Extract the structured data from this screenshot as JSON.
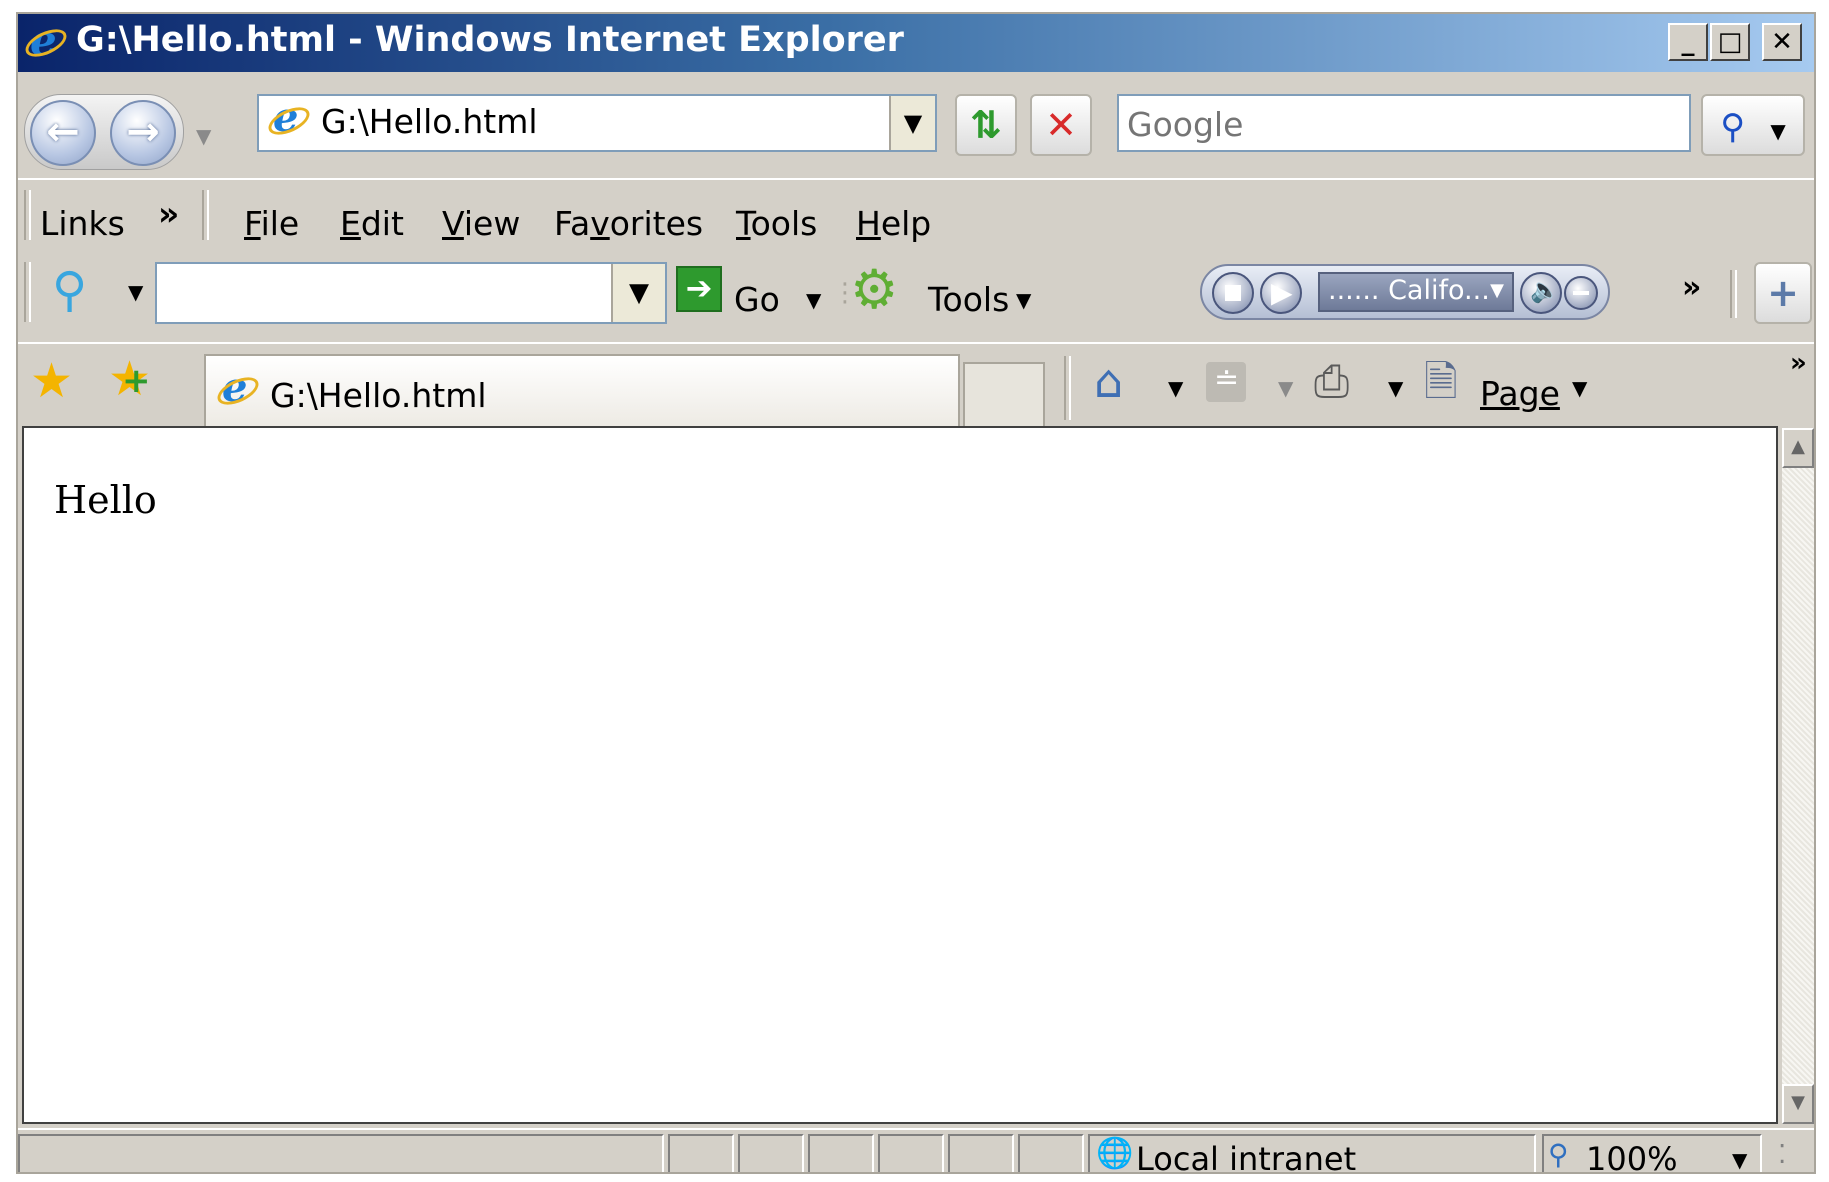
{
  "window": {
    "title": "G:\\Hello.html - Windows Internet Explorer",
    "controls": {
      "minimize": "_",
      "maximize": "□",
      "close": "✕"
    }
  },
  "navigation": {
    "back_icon": "back-arrow-icon",
    "forward_icon": "forward-arrow-icon",
    "address": "G:\\Hello.html",
    "search_placeholder": "Google"
  },
  "links_bar": {
    "label": "Links",
    "chevron": "»"
  },
  "menu": {
    "items": [
      {
        "label": "File",
        "key": "F",
        "rest": "ile"
      },
      {
        "label": "Edit",
        "key": "E",
        "rest": "dit"
      },
      {
        "label": "View",
        "key": "V",
        "rest": "iew"
      },
      {
        "label": "Favorites",
        "pre": "Fa",
        "key": "v",
        "rest": "orites"
      },
      {
        "label": "Tools",
        "key": "T",
        "rest": "ools"
      },
      {
        "label": "Help",
        "key": "H",
        "rest": "elp"
      }
    ]
  },
  "google_toolbar": {
    "go_label": "Go",
    "tools_label": "Tools",
    "station_label": "...... Califo...",
    "chevron": "»",
    "add_button": "+"
  },
  "tab": {
    "title": "G:\\Hello.html"
  },
  "command_bar": {
    "page_label": "Page",
    "chevron": "»"
  },
  "page": {
    "body_text": "Hello"
  },
  "status_bar": {
    "zone": "Local intranet",
    "zoom": "100%"
  },
  "colors": {
    "titlebar_start": "#0a246a",
    "titlebar_end": "#a6caf0",
    "chrome": "#d4d0c8",
    "go_green": "#2e9a2e",
    "stop_red": "#d82a2a"
  }
}
